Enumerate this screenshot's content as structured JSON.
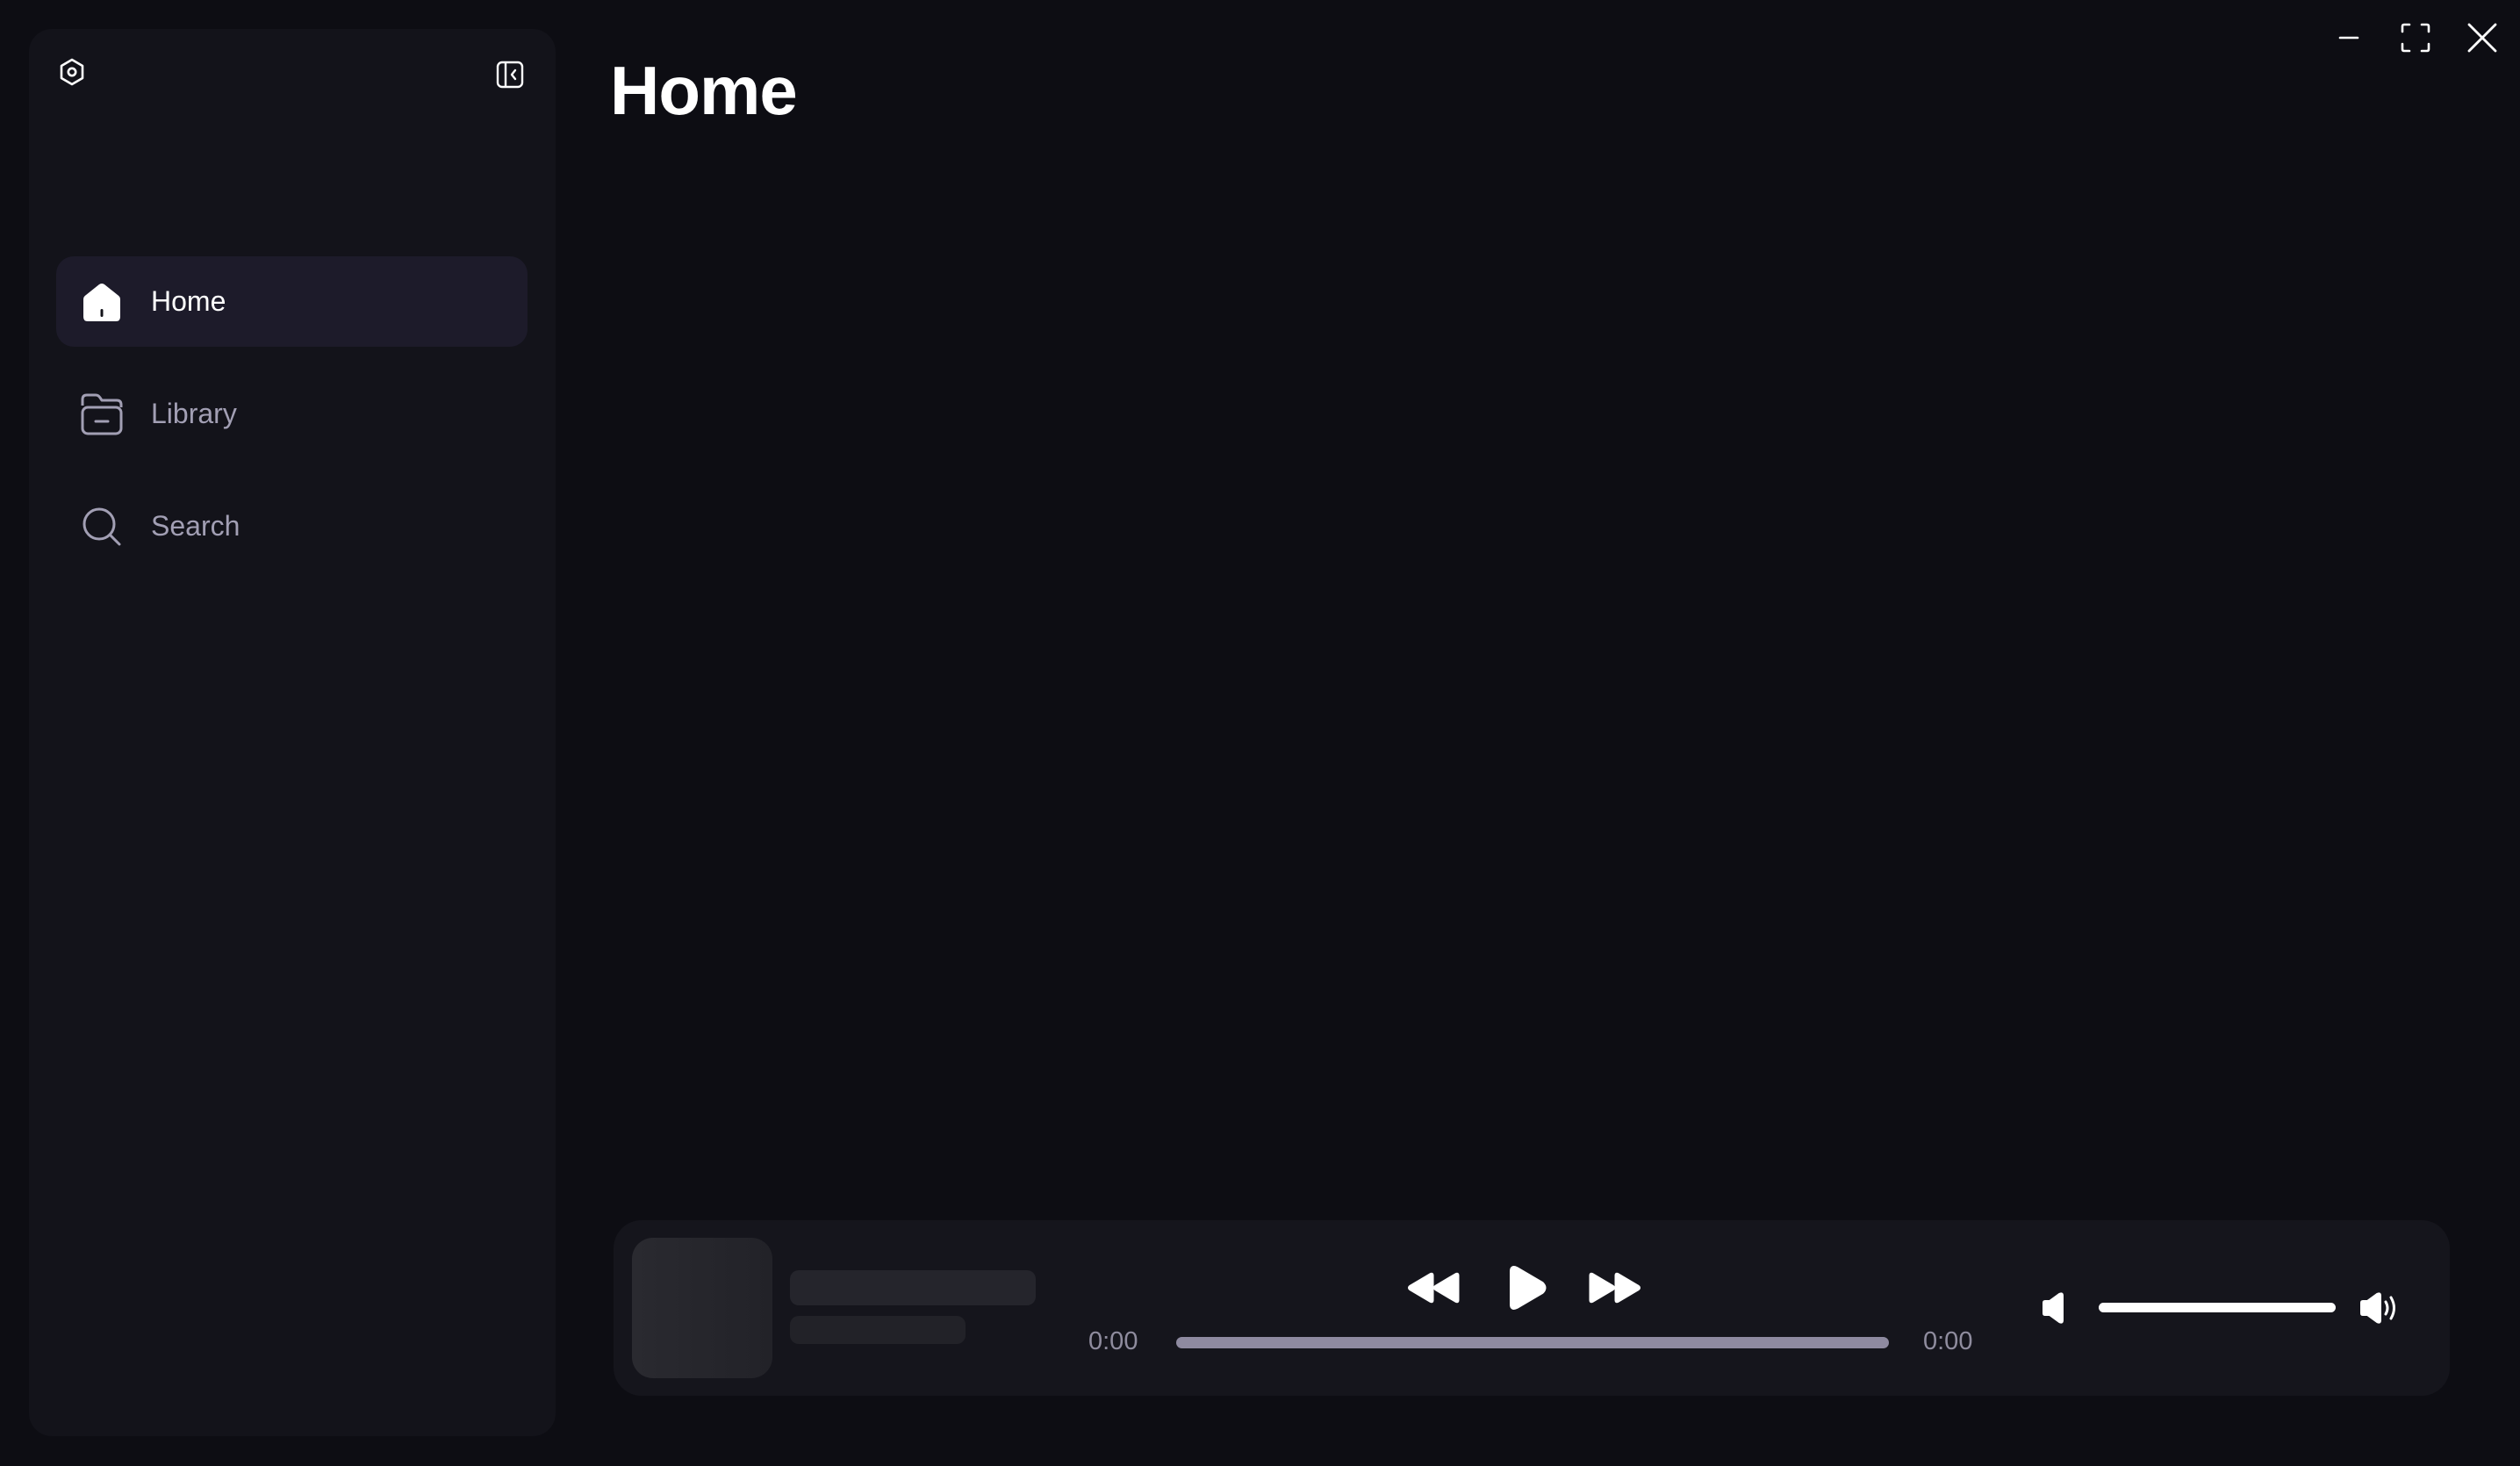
{
  "window": {
    "controls": [
      "minimize",
      "maximize",
      "close"
    ]
  },
  "sidebar": {
    "settings_icon": "settings-hexagon-icon",
    "collapse_icon": "sidebar-collapse-icon",
    "items": [
      {
        "label": "Home",
        "icon": "home-icon",
        "active": true
      },
      {
        "label": "Library",
        "icon": "folder-icon",
        "active": false
      },
      {
        "label": "Search",
        "icon": "search-icon",
        "active": false
      }
    ]
  },
  "main": {
    "title": "Home"
  },
  "player": {
    "elapsed": "0:00",
    "duration": "0:00",
    "progress": 0,
    "volume": 1.0,
    "track_loaded": false
  },
  "colors": {
    "background": "#0d0d13",
    "sidebar": "#13131a",
    "active_item": "#1d1b2a",
    "muted_text": "#a29fb4",
    "progress_track": "#8e8aa0"
  }
}
